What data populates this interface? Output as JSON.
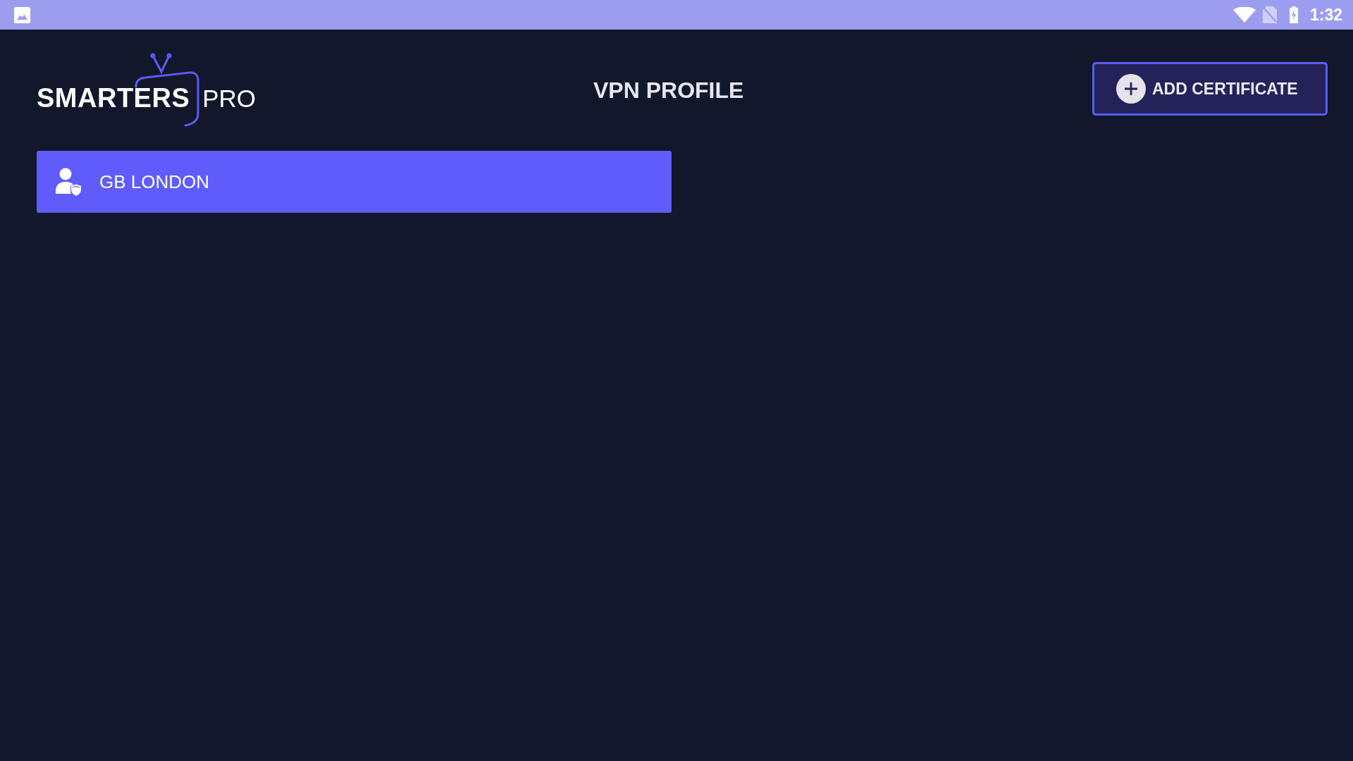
{
  "status_bar": {
    "time": "1:32"
  },
  "header": {
    "logo": {
      "primary": "SMARTERS",
      "secondary": "PRO"
    },
    "title": "VPN PROFILE",
    "action_button": {
      "label": "ADD CERTIFICATE"
    }
  },
  "profiles": [
    {
      "name": "GB LONDON",
      "selected": true
    }
  ]
}
